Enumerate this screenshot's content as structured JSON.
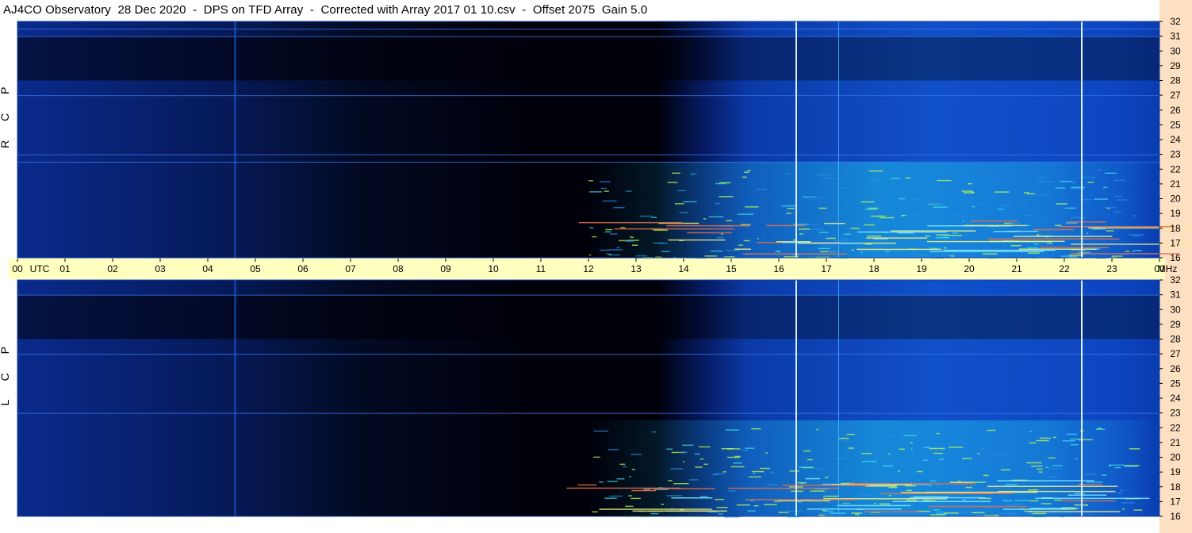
{
  "title": "AJ4CO Observatory  28 Dec 2020  -  DPS on TFD Array  -  Corrected with Array 2017 01 10.csv  -  Offset 2075  Gain 5.0",
  "colors": {
    "background": "#ffffff",
    "time_axis_band": "#ffffc0",
    "frequency_strip": "#fde0c2",
    "spectrogram_dark": "#00000a",
    "spectrogram_mid": "#0b3fb0",
    "spectrogram_bright": "#19c0e6",
    "hot_spots": "#c8ff50"
  },
  "chart_data": [
    {
      "type": "heatmap",
      "panel": "upper",
      "side_label": "R C P",
      "x_tick_labels": [
        "00",
        "UTC",
        "01",
        "02",
        "03",
        "04",
        "05",
        "06",
        "07",
        "08",
        "09",
        "10",
        "11",
        "12",
        "13",
        "14",
        "15",
        "16",
        "17",
        "18",
        "19",
        "20",
        "21",
        "22",
        "23",
        "00",
        "MHz"
      ],
      "x_range_utc_hours": [
        0,
        24
      ],
      "y_tick_labels": [
        "32",
        "31",
        "30",
        "29",
        "28",
        "27",
        "26",
        "25",
        "24",
        "23",
        "22",
        "21",
        "20",
        "19",
        "18",
        "17",
        "16"
      ],
      "y_range_mhz": [
        16,
        32
      ],
      "features": {
        "solar_activity_start_utc": 12.0,
        "solar_activity_end_utc": 23.5,
        "vertical_bright_lines_utc": [
          16.35,
          17.25,
          22.35
        ],
        "horizontal_lines_mhz": [
          31.5,
          31.0,
          27.0,
          23.0,
          22.5
        ]
      }
    },
    {
      "type": "heatmap",
      "panel": "lower",
      "side_label": "L C P",
      "x_range_utc_hours": [
        0,
        24
      ],
      "y_tick_labels": [
        "32",
        "31",
        "30",
        "29",
        "28",
        "27",
        "26",
        "25",
        "24",
        "23",
        "22",
        "21",
        "20",
        "19",
        "18",
        "17",
        "16"
      ],
      "y_range_mhz": [
        16,
        32
      ],
      "features": {
        "solar_activity_start_utc": 12.0,
        "solar_activity_end_utc": 23.5,
        "vertical_bright_lines_utc": [
          16.35,
          17.25,
          22.35
        ],
        "horizontal_lines_mhz": [
          31.0,
          27.0,
          23.0
        ]
      }
    }
  ]
}
